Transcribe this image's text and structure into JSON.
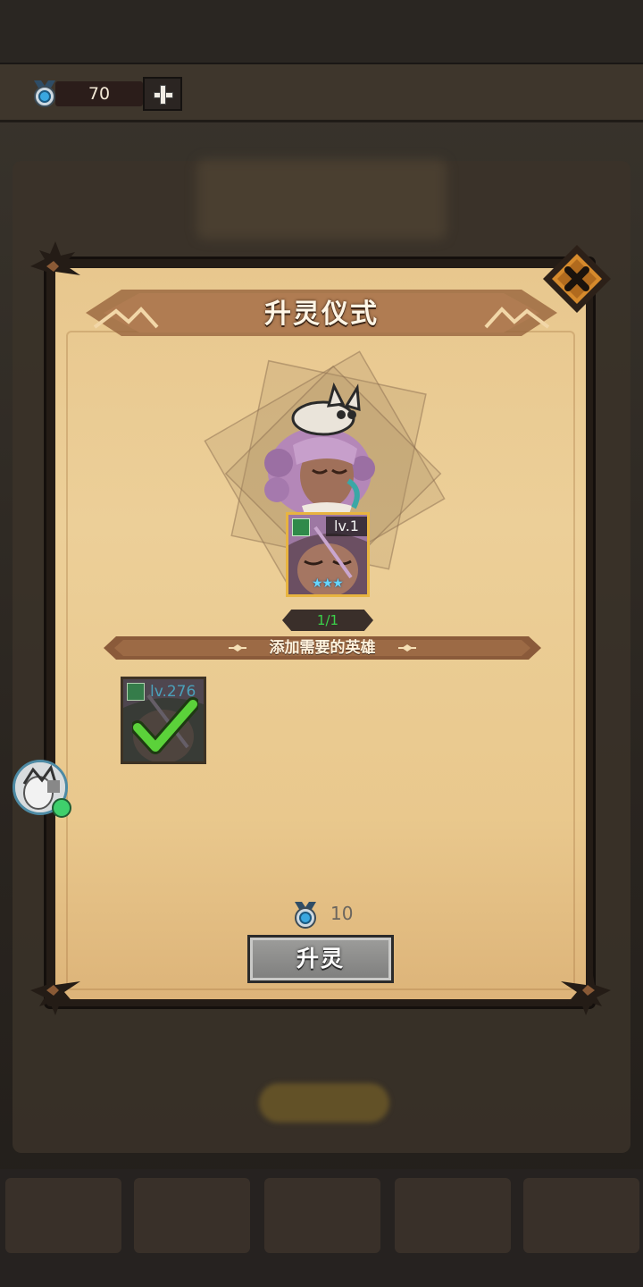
{
  "resource": {
    "icon": "medal-gem-icon",
    "value": "70",
    "add_icon": "plus-icon"
  },
  "dialog": {
    "title": "升灵仪式",
    "close_icon": "close-icon",
    "target_hero": {
      "level": "lv.1",
      "stars": "★★★",
      "class_icon": "bow-class-icon"
    },
    "count": "1/1",
    "section_label": "添加需要的英雄",
    "material_hero": {
      "level": "lv.276",
      "selected": true,
      "class_icon": "bow-class-icon",
      "check_icon": "checkmark-icon"
    },
    "cost": {
      "icon": "medal-gem-icon",
      "value": "10"
    },
    "button": "升灵"
  },
  "colors": {
    "paper": "#eccf98",
    "frame": "#241c16",
    "gold_border": "#e8b440",
    "count_green": "#3bd24a",
    "check_green": "#5bd23a",
    "button_gray": "#8e8e8c"
  }
}
